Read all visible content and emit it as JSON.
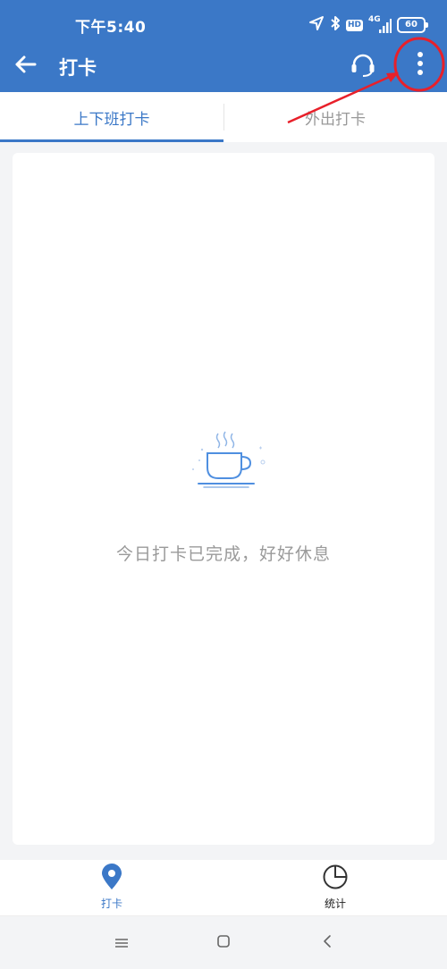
{
  "status_bar": {
    "time": "下午5:40",
    "hd": "HD",
    "network": "4G",
    "battery": "60"
  },
  "header": {
    "title": "打卡",
    "icons": {
      "back": "arrow-left-icon",
      "support": "headset-icon",
      "more": "more-vertical-icon"
    }
  },
  "tabs": [
    {
      "label": "上下班打卡",
      "active": true
    },
    {
      "label": "外出打卡",
      "active": false
    }
  ],
  "content": {
    "empty_message": "今日打卡已完成，好好休息",
    "illustration": "coffee-cup-icon"
  },
  "bottom_nav": [
    {
      "label": "打卡",
      "icon": "location-pin-icon",
      "active": true
    },
    {
      "label": "统计",
      "icon": "pie-chart-icon",
      "active": false
    }
  ],
  "colors": {
    "primary": "#3b78c7",
    "annotation": "#e8202a",
    "muted_text": "#9a9a9a"
  }
}
